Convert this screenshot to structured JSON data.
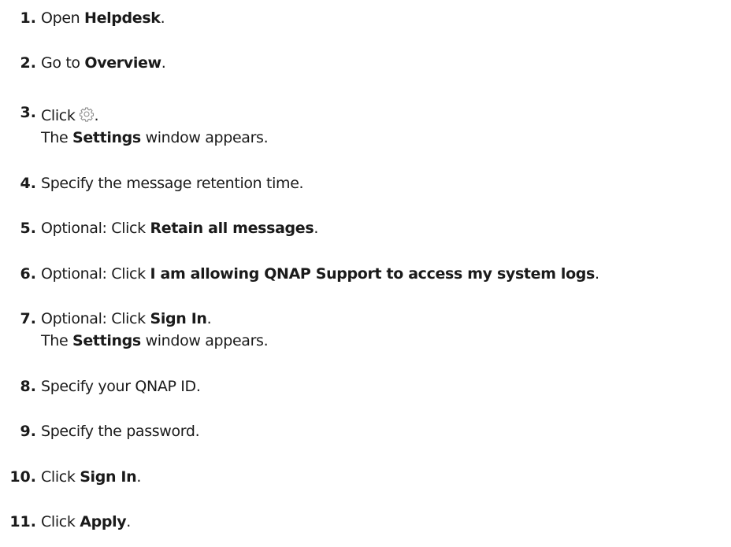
{
  "steps": [
    {
      "num": "1.",
      "pre": "Open ",
      "bold": "Helpdesk",
      "post": "."
    },
    {
      "num": "2.",
      "pre": "Go to ",
      "bold": "Overview",
      "post": "."
    },
    {
      "num": "3.",
      "pre": "Click",
      "icon": "gear-icon",
      "post": ".",
      "sub_pre": "The ",
      "sub_bold": "Settings",
      "sub_post": " window appears."
    },
    {
      "num": "4.",
      "text": "Specify the message retention time."
    },
    {
      "num": "5.",
      "pre": "Optional: Click ",
      "bold": "Retain all messages",
      "post": "."
    },
    {
      "num": "6.",
      "pre": "Optional: Click ",
      "bold": "I am allowing QNAP Support to access my system logs",
      "post": "."
    },
    {
      "num": "7.",
      "pre": "Optional: Click ",
      "bold": "Sign In",
      "post": ".",
      "sub_pre": "The ",
      "sub_bold": "Settings",
      "sub_post": " window appears."
    },
    {
      "num": "8.",
      "text": "Specify your QNAP ID."
    },
    {
      "num": "9.",
      "text": "Specify the password."
    },
    {
      "num": "10.",
      "pre": "Click ",
      "bold": "Sign In",
      "post": "."
    },
    {
      "num": "11.",
      "pre": "Click ",
      "bold": "Apply",
      "post": "."
    }
  ]
}
